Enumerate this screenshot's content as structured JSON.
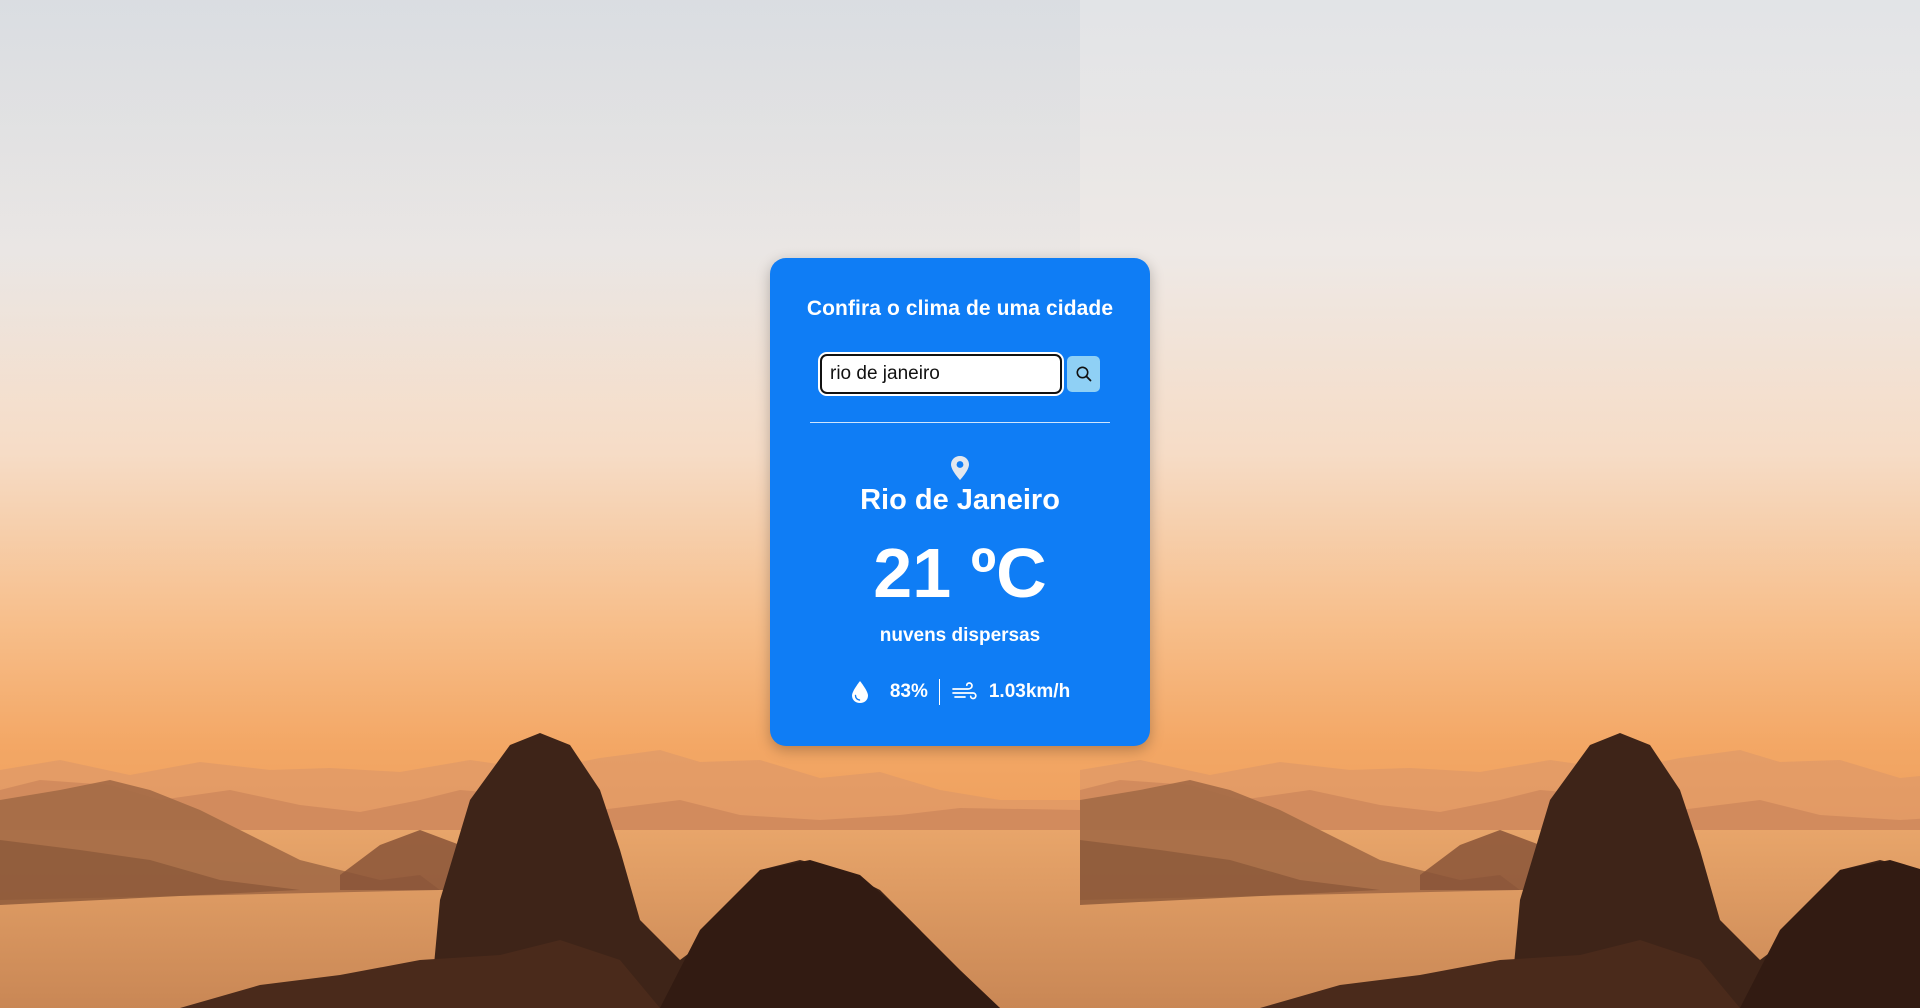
{
  "app": {
    "title": "Confira o clima de uma cidade"
  },
  "search": {
    "value": "rio de janeiro",
    "placeholder": "",
    "button_icon": "search-icon"
  },
  "weather": {
    "location_icon": "map-pin-icon",
    "city": "Rio de Janeiro",
    "temperature": "21 ºC",
    "description": "nuvens dispersas",
    "humidity_icon": "water-drop-icon",
    "humidity": "83%",
    "wind_icon": "wind-icon",
    "wind": "1.03km/h"
  },
  "colors": {
    "card_background": "#0f7df5",
    "search_button": "#8fd0f5",
    "text": "#ffffff"
  }
}
